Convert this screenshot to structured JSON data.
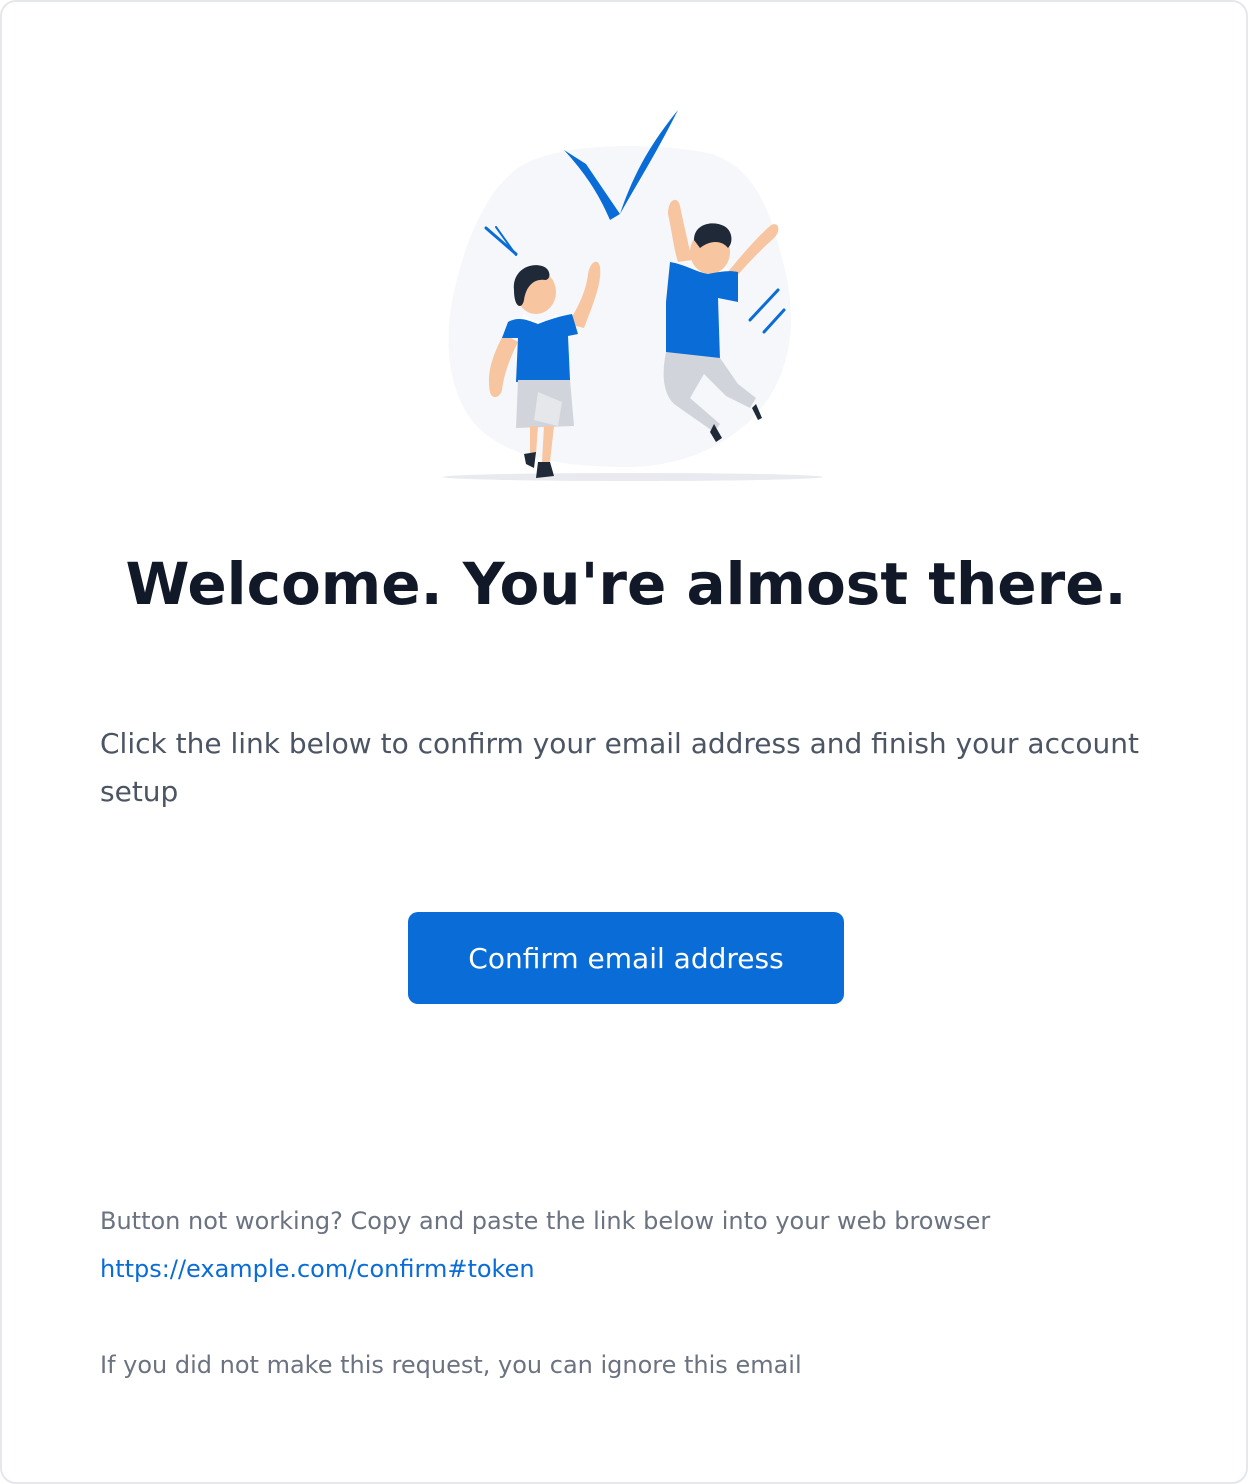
{
  "email": {
    "title": "Welcome. You're almost there.",
    "intro": "Click the link below to confirm your email address and finish your account setup",
    "cta_label": "Confirm email address",
    "help_text": "Button not working? Copy and paste the link below into your web browser",
    "link_text": "https://example.com/confirm#token",
    "ignore_text": "If you did not make this request, you can ignore this email"
  },
  "illustration": {
    "icon": "celebration-checkmark-illustration"
  },
  "colors": {
    "accent": "#0a6cd6",
    "title": "#111827",
    "body_text": "#4b5563",
    "muted_text": "#6b7280",
    "border": "#e5e7eb"
  }
}
